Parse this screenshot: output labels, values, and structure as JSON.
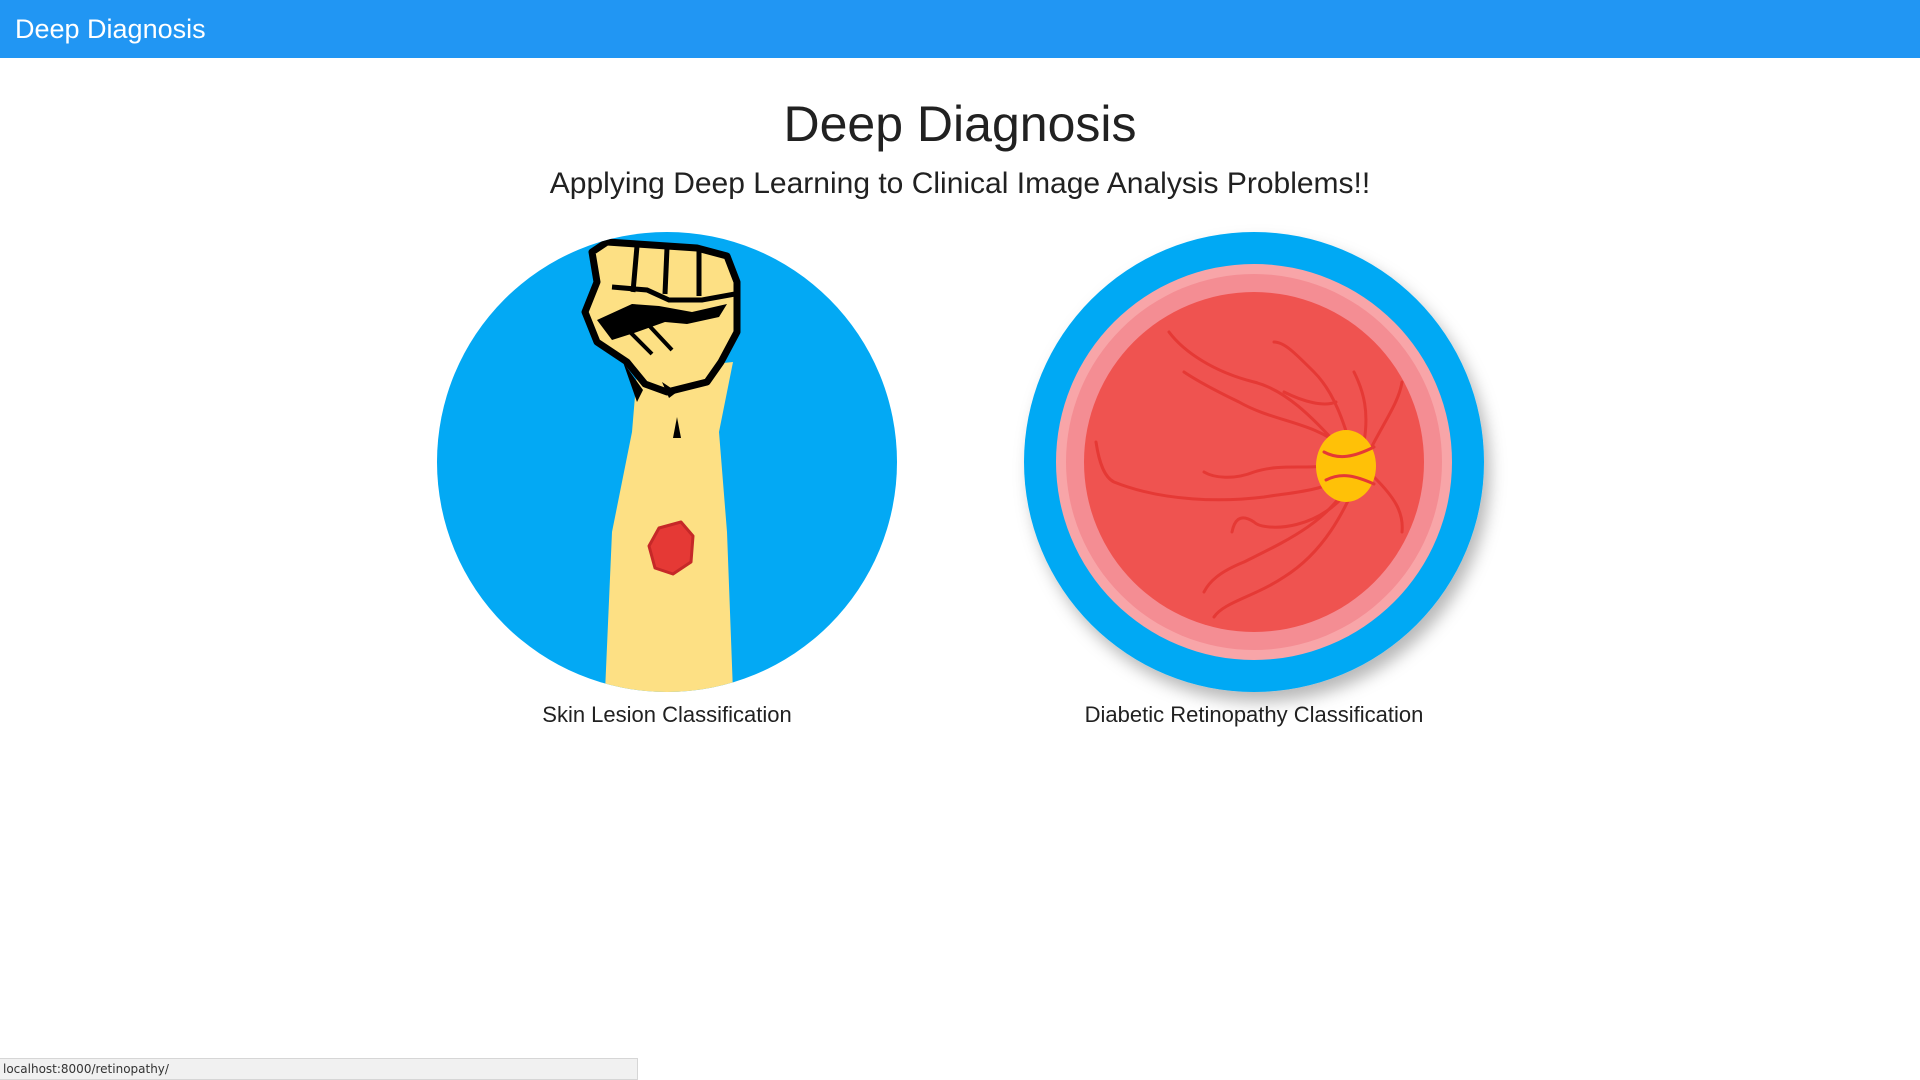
{
  "appbar": {
    "title": "Deep Diagnosis"
  },
  "hero": {
    "title": "Deep Diagnosis",
    "subtitle": "Applying Deep Learning to Clinical Image Analysis Problems!!"
  },
  "cards": [
    {
      "label": "Skin Lesion Classification",
      "icon": "arm-skin-lesion-icon"
    },
    {
      "label": "Diabetic Retinopathy Classification",
      "icon": "retina-fundus-icon"
    }
  ],
  "status_bar": {
    "url": "localhost:8000/retinopathy/"
  },
  "colors": {
    "appbar": "#2196f3",
    "icon_background": "#03a9f4",
    "skin": "#fde084",
    "lesion": "#e53935",
    "retina": "#ef5350",
    "retina_ring": "#f8a5a8",
    "optic_disc": "#ffc107"
  }
}
